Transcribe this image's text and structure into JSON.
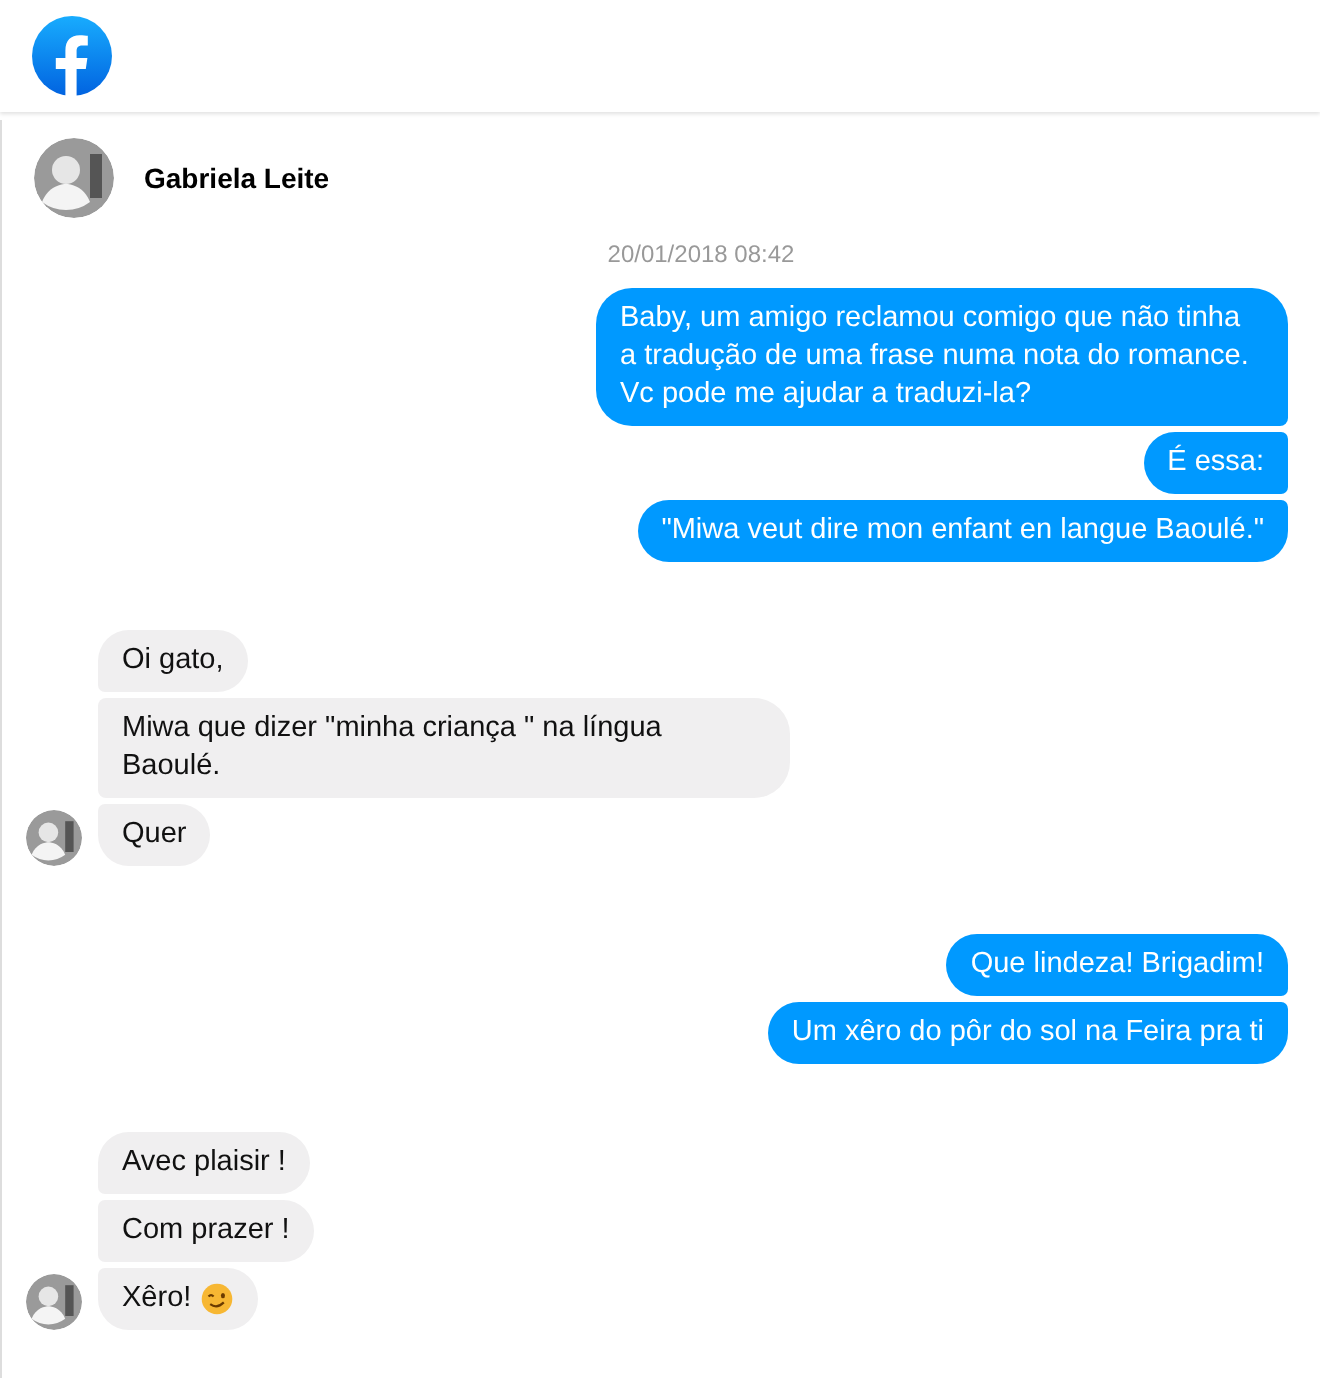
{
  "contact": {
    "name": "Gabriela Leite"
  },
  "timestamp": "20/01/2018 08:42",
  "groups": [
    {
      "kind": "outgoing",
      "messages": [
        {
          "text": "Baby, um amigo reclamou comigo que não tinha a tradução de uma frase numa nota do romance. Vc pode me ajudar a traduzi-la?",
          "emoji": false
        },
        {
          "text": "É essa:",
          "emoji": false
        },
        {
          "text": "\"Miwa veut dire mon enfant en langue Baoulé.\"",
          "emoji": false
        }
      ]
    },
    {
      "kind": "incoming",
      "messages": [
        {
          "text": "Oi gato,",
          "emoji": false
        },
        {
          "text": "Miwa que dizer \"minha criança \" na língua Baoulé.",
          "emoji": false
        },
        {
          "text": "Quer",
          "emoji": false
        }
      ]
    },
    {
      "kind": "outgoing",
      "messages": [
        {
          "text": "Que lindeza! Brigadim!",
          "emoji": false
        },
        {
          "text": "Um xêro do pôr do sol na Feira pra ti",
          "emoji": false
        }
      ]
    },
    {
      "kind": "incoming",
      "messages": [
        {
          "text": "Avec plaisir !",
          "emoji": false
        },
        {
          "text": "Com prazer !",
          "emoji": false
        },
        {
          "text": "Xêro!",
          "emoji": true
        }
      ]
    }
  ]
}
